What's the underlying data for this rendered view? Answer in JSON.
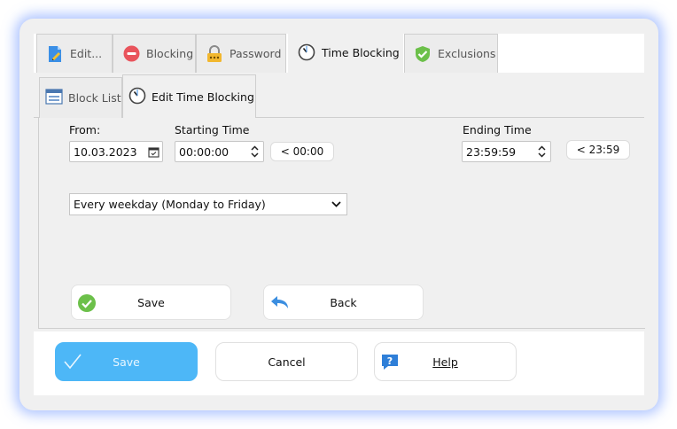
{
  "tabs": [
    {
      "label": "Edit...",
      "icon": "edit-document-icon"
    },
    {
      "label": "Blocking",
      "icon": "block-icon"
    },
    {
      "label": "Password",
      "icon": "lock-icon"
    },
    {
      "label": "Time Blocking",
      "icon": "clock-icon",
      "active": true
    },
    {
      "label": "Exclusions",
      "icon": "shield-check-icon"
    }
  ],
  "subtabs": [
    {
      "label": "Block List",
      "icon": "list-icon"
    },
    {
      "label": "Edit Time Blocking",
      "icon": "clock-icon",
      "active": true
    }
  ],
  "form": {
    "from_label": "From:",
    "from_date": "10.03.2023",
    "start_label": "Starting Time",
    "start_time": "00:00:00",
    "start_quick": "< 00:00",
    "end_label": "Ending Time",
    "end_time": "23:59:59",
    "end_quick": "< 23:59",
    "repeat_selected": "Every weekday (Monday to Friday)"
  },
  "panel_buttons": {
    "save": "Save",
    "back": "Back"
  },
  "footer": {
    "save": "Save",
    "cancel": "Cancel",
    "help": "Help"
  },
  "colors": {
    "primary": "#4db7f7",
    "check_green": "#6cc04a",
    "stop_red": "#e9545c",
    "back_blue": "#3b8ee0"
  }
}
